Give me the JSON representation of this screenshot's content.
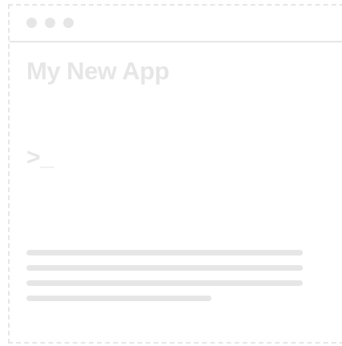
{
  "app": {
    "title": "My New App",
    "prompt": ">_"
  },
  "text_placeholder": {
    "line_count": 4
  },
  "colors": {
    "wireframe_gray": "#e6e6e6",
    "background": "#ffffff"
  }
}
